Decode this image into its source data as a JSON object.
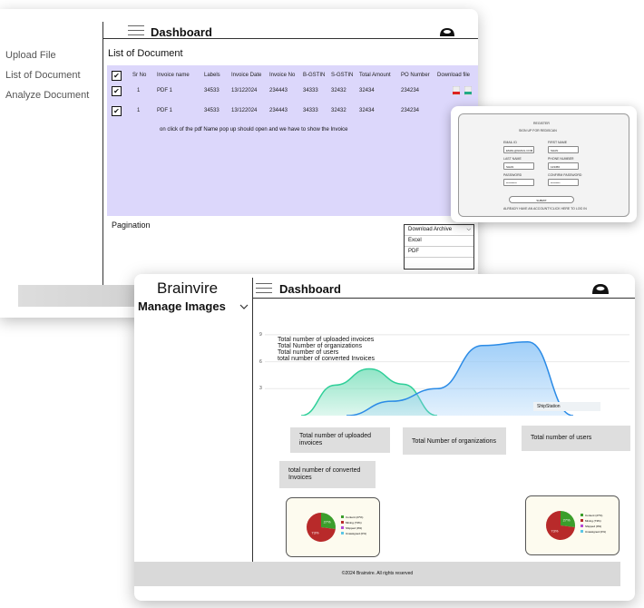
{
  "back_window": {
    "sidebar": [
      "Upload File",
      "List of Document",
      "Analyze Document"
    ],
    "title": "Dashboard",
    "subtitle": "List of Document",
    "columns": [
      "Sr No",
      "Invoice name",
      "Labels",
      "Invoice Date",
      "Invoice No",
      "B-GSTIN",
      "S-GSTIN",
      "Total Amount",
      "PO Number",
      "Download file"
    ],
    "rows": [
      [
        "1",
        "PDF 1",
        "34533",
        "13/122024",
        "234443",
        "34333",
        "32432",
        "32434",
        "234234"
      ],
      [
        "1",
        "PDF 1",
        "34533",
        "13/122024",
        "234443",
        "34333",
        "32432",
        "32434",
        "234234"
      ]
    ],
    "note": "on click of the pdf Name pop up should open and we have to show the Invoice",
    "pagination": "Pagination",
    "download_archive": "Download Archive",
    "download_options": [
      "Excel",
      "PDF"
    ]
  },
  "signup": {
    "heading": "REGISTER",
    "subheading": "SIGN UP FOR REDISCAN",
    "email_label": "EMAIL ID",
    "email_value": "EMAIL@GMAIL.COM",
    "first_name_label": "FIRST NAME",
    "first_name_value": "SHAN",
    "last_name_label": "LAST NAME",
    "last_name_value": "SHAN",
    "phone_label": "PHONE NUMBER",
    "phone_value": "123456",
    "password_label": "PASSWORD",
    "password_value": "**********",
    "confirm_label": "CONFIRM PASSWORD",
    "confirm_value": "*********",
    "submit": "SUBMIT",
    "login_text": "ALREADY HAVE AN ACCOUNT?CLICK HERE TO LOG IN"
  },
  "front_window": {
    "brand": "Brainvire",
    "title": "Dashboard",
    "manage_images": "Manage Images",
    "chart_tooltip": "ShipStation",
    "stats": [
      "Total number of uploaded invoices",
      "Total Number of organizations",
      "Total number of users",
      "total number of converted Invoices"
    ],
    "footer": "©2024 Brainvire. All rights reserved"
  },
  "chart_data": {
    "type": "area",
    "y_ticks": [
      3,
      6,
      9
    ],
    "legend": [
      "Total number of uploaded invoices",
      "Total Number of organizations",
      "Total number of users",
      "total number of converted Invoices"
    ],
    "series": [
      {
        "color": "#7ee0bd",
        "values": [
          0,
          3.4,
          5.2,
          3.5,
          0
        ]
      },
      {
        "color": "#8fc6f7",
        "values": [
          0,
          1.6,
          3,
          7.8,
          8.2,
          0
        ]
      }
    ]
  },
  "pie_charts": [
    {
      "slices": [
        {
          "label": "Content (27%)",
          "value": 27,
          "color": "#3b9e2b"
        },
        {
          "label": "Mining (73%)",
          "value": 73,
          "color": "#b82a2a"
        }
      ],
      "legend": [
        "Content (27%)",
        "Mining (73%)",
        "Shipped (0%)",
        "Unassigned (0%)"
      ],
      "slice_labels": [
        "27%",
        "73%"
      ]
    },
    {
      "slices": [
        {
          "label": "Content (27%)",
          "value": 27,
          "color": "#3b9e2b"
        },
        {
          "label": "Mining (73%)",
          "value": 73,
          "color": "#b82a2a"
        }
      ],
      "legend": [
        "Content (27%)",
        "Mining (73%)",
        "Shipped (0%)",
        "Unassigned (0%)"
      ],
      "slice_labels": [
        "27%",
        "73%"
      ]
    }
  ],
  "colors": {
    "table_bg": "#dcd7fb",
    "card_bg": "#dedede"
  }
}
